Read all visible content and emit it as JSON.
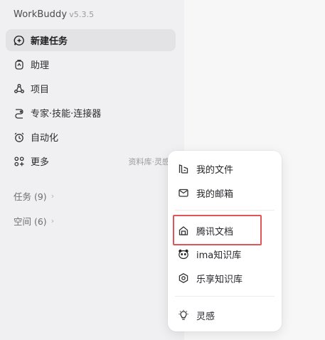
{
  "app": {
    "name": "WorkBuddy",
    "version": "v5.3.5"
  },
  "nav": {
    "new_task": "新建任务",
    "assistant": "助理",
    "projects": "项目",
    "experts": "专家·技能·连接器",
    "automation": "自动化",
    "more": "更多",
    "more_hint": "资料库·灵感"
  },
  "sections": {
    "tasks": "任务 (9)",
    "spaces": "空间 (6)"
  },
  "popup": {
    "my_files": "我的文件",
    "my_mail": "我的邮箱",
    "tencent_docs": "腾讯文档",
    "ima": "ima知识库",
    "lexiang": "乐享知识库",
    "inspiration": "灵感"
  },
  "colors": {
    "highlight": "#e0555a"
  }
}
